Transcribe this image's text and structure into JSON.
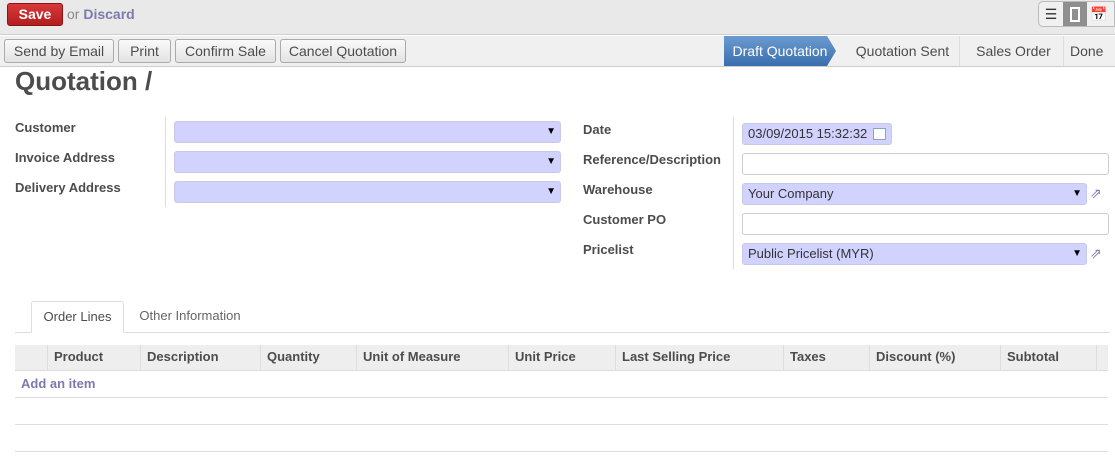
{
  "toolbar": {
    "save": "Save",
    "or": "or",
    "discard": "Discard"
  },
  "view_switcher": {
    "icons": [
      "list-icon",
      "form-icon",
      "calendar-icon"
    ],
    "active": "form"
  },
  "actions": [
    "Send by Email",
    "Print",
    "Confirm Sale",
    "Cancel Quotation"
  ],
  "statusbar": {
    "stages": [
      "Draft Quotation",
      "Quotation Sent",
      "Sales Order",
      "Done"
    ],
    "active": 0,
    "active_color": "#4a7fbf"
  },
  "title": "Quotation /",
  "left_fields": [
    {
      "label": "Customer",
      "value": ""
    },
    {
      "label": "Invoice Address",
      "value": ""
    },
    {
      "label": "Delivery Address",
      "value": ""
    }
  ],
  "right_fields": {
    "date": {
      "label": "Date",
      "value": "03/09/2015 15:32:32"
    },
    "reference": {
      "label": "Reference/Description",
      "value": ""
    },
    "warehouse": {
      "label": "Warehouse",
      "value": "Your Company"
    },
    "customer_po": {
      "label": "Customer PO",
      "value": ""
    },
    "pricelist": {
      "label": "Pricelist",
      "value": "Public Pricelist (MYR)"
    }
  },
  "tabs": [
    "Order Lines",
    "Other Information"
  ],
  "active_tab": 0,
  "table": {
    "columns": [
      "Product",
      "Description",
      "Quantity",
      "Unit of Measure",
      "Unit Price",
      "Last Selling Price",
      "Taxes",
      "Discount (%)",
      "Subtotal"
    ],
    "add_item": "Add an item"
  },
  "colors": {
    "save": "#c62828",
    "required_field": "#d2d2ff",
    "link": "#7c7bad"
  }
}
